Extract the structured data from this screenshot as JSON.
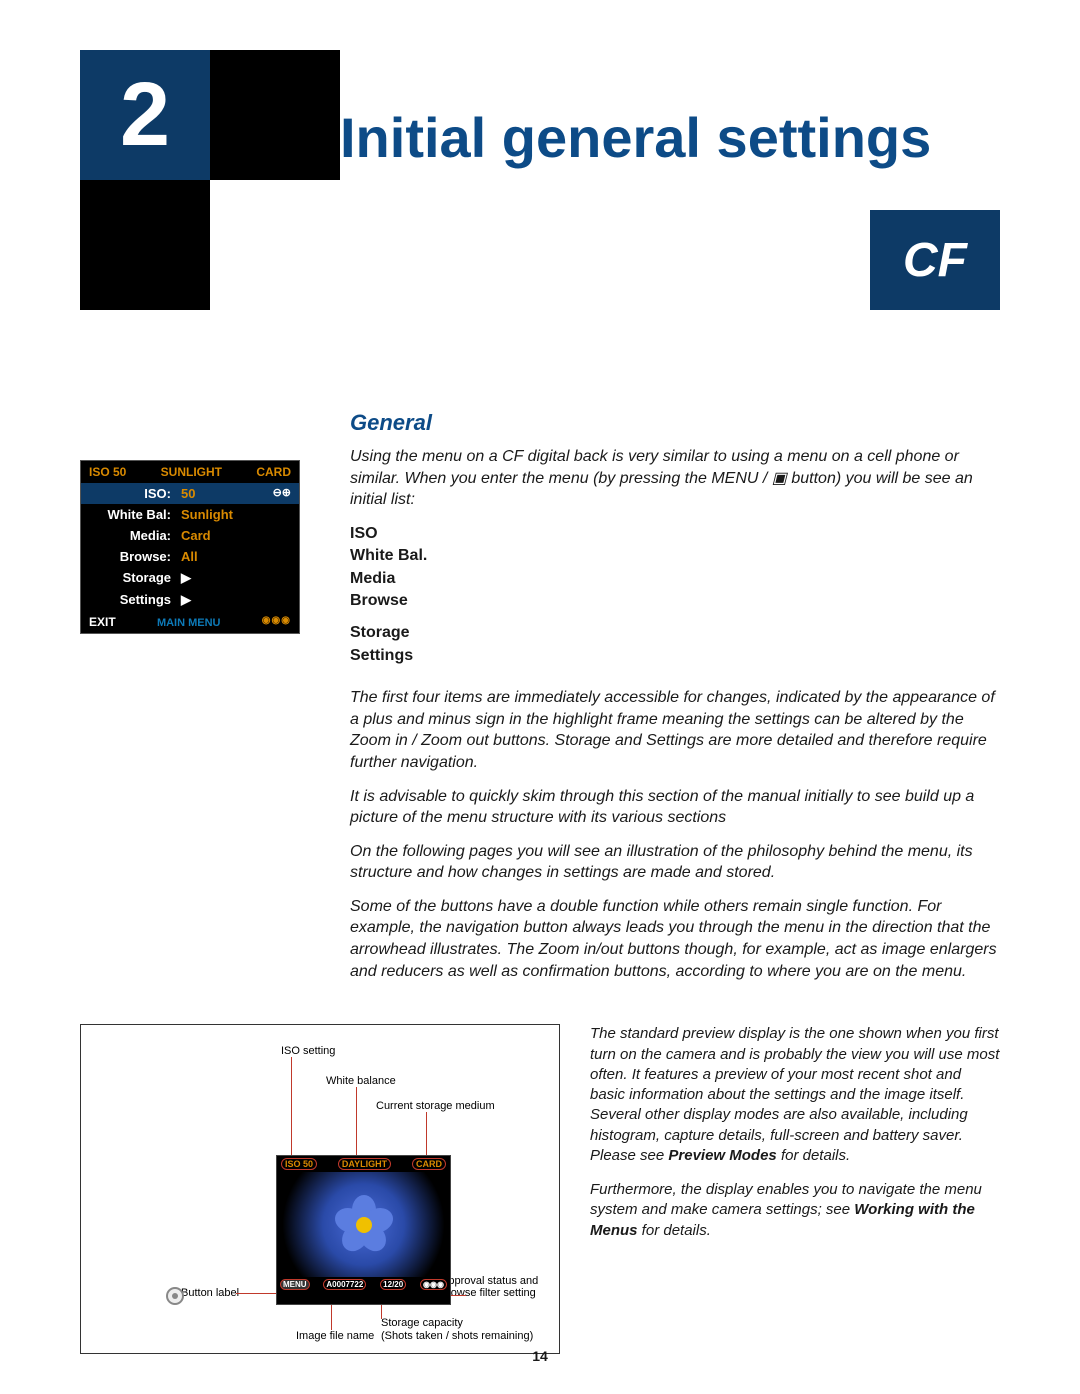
{
  "chapter_num": "2",
  "title": "Initial general settings",
  "cf_badge": "CF",
  "subhead_general": "General",
  "intro_para": "Using the menu on a CF digital back is very similar to using a menu on a cell phone or similar. When you enter the menu (by pressing the MENU / ▣ button) you will be see an initial list:",
  "menu_list": {
    "items": [
      "ISO",
      "White Bal.",
      "Media",
      "Browse"
    ],
    "items2": [
      "Storage",
      "Settings"
    ]
  },
  "para1": "The first four items are immediately accessible for changes, indicated by the appearance of a plus and minus sign in the highlight frame meaning the settings can be altered by the Zoom in / Zoom out buttons. Storage and Settings are more detailed and therefore require further navigation.",
  "para2": "It is advisable to quickly skim through this section of the manual initially to see build up a picture of the menu structure with its various sections",
  "para3": "On the following pages you will see an illustration of the philosophy behind the menu, its structure and how changes in settings are made and stored.",
  "para4": "Some of the buttons have a double function while others remain single function. For example, the navigation button always leads you through the menu in the direction that the arrowhead illustrates. The Zoom in/out buttons though, for example, act as image enlargers and reducers as well as confirmation buttons, according to where you are on the menu.",
  "lcd": {
    "header": {
      "left": "ISO 50",
      "mid": "SUNLIGHT",
      "right": "CARD"
    },
    "rows": [
      {
        "k": "ISO:",
        "v": "50",
        "sel": true
      },
      {
        "k": "White Bal:",
        "v": "Sunlight"
      },
      {
        "k": "Media:",
        "v": "Card"
      },
      {
        "k": "Browse:",
        "v": "All"
      },
      {
        "k": "Storage",
        "arrow": "▶"
      },
      {
        "k": "Settings",
        "arrow": "▶"
      }
    ],
    "footer": {
      "left": "EXIT",
      "mid": "MAIN MENU",
      "right": "◉◉◉"
    }
  },
  "diagram": {
    "callouts": {
      "iso": "ISO setting",
      "wb": "White balance",
      "medium": "Current storage medium",
      "btn": "Button label",
      "filename": "Image file name",
      "capacity": "Storage capacity",
      "shots": "(Shots taken / shots remaining)",
      "approval": "Approval status and browse filter setting"
    },
    "preview_header": {
      "left": "ISO 50",
      "mid": "DAYLIGHT",
      "right": "CARD"
    },
    "preview_footer": {
      "menu": "MENU",
      "file": "A0007722",
      "cap": "12/20",
      "approval": "◉◉◉"
    }
  },
  "side_text": {
    "p1_a": "The standard preview display is the one shown when you first turn on the camera and is probably the view you will use most often. It features a preview of your most recent shot and basic information about the settings and the image itself. Several other display modes are also available, including histogram, capture details, full-screen and battery saver. Please see ",
    "p1_b": "Preview Modes",
    "p1_c": " for details.",
    "p2_a": "Furthermore, the display enables you to navigate the menu system and make camera settings; see ",
    "p2_b": "Working with the Menus",
    "p2_c": " for details."
  },
  "page_num": "14"
}
